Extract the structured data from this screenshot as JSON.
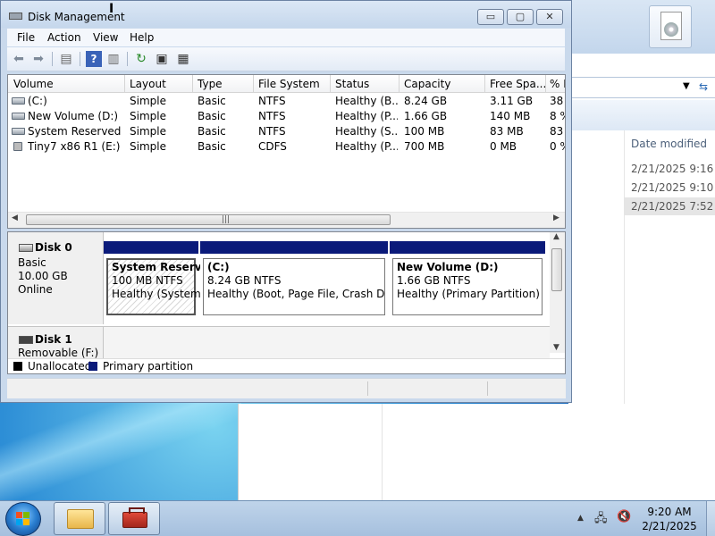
{
  "window": {
    "title": "Disk Management",
    "menu": [
      "File",
      "Action",
      "View",
      "Help"
    ],
    "controls": {
      "minimize": "▭",
      "maximize": "▢",
      "close": "✕"
    }
  },
  "volume_list": {
    "columns": [
      "Volume",
      "Layout",
      "Type",
      "File System",
      "Status",
      "Capacity",
      "Free Spa...",
      "% F"
    ],
    "rows": [
      {
        "volume": "(C:)",
        "layout": "Simple",
        "type": "Basic",
        "fs": "NTFS",
        "status": "Healthy (B...",
        "capacity": "8.24 GB",
        "free": "3.11 GB",
        "pct": "38",
        "icon": "drive-icon"
      },
      {
        "volume": "New Volume (D:)",
        "layout": "Simple",
        "type": "Basic",
        "fs": "NTFS",
        "status": "Healthy (P...",
        "capacity": "1.66 GB",
        "free": "140 MB",
        "pct": "8 %",
        "icon": "drive-icon"
      },
      {
        "volume": "System Reserved",
        "layout": "Simple",
        "type": "Basic",
        "fs": "NTFS",
        "status": "Healthy (S...",
        "capacity": "100 MB",
        "free": "83 MB",
        "pct": "83",
        "icon": "drive-icon"
      },
      {
        "volume": "Tiny7 x86 R1 (E:)",
        "layout": "Simple",
        "type": "Basic",
        "fs": "CDFS",
        "status": "Healthy (P...",
        "capacity": "700 MB",
        "free": "0 MB",
        "pct": "0 %",
        "icon": "cd-drive-icon"
      }
    ]
  },
  "disks": [
    {
      "name": "Disk 0",
      "kind": "Basic",
      "size": "10.00 GB",
      "state": "Online",
      "partitions": [
        {
          "title": "System Reserved",
          "size": "100 MB NTFS",
          "status": "Healthy (System,"
        },
        {
          "title": "(C:)",
          "size": "8.24 GB NTFS",
          "status": "Healthy (Boot, Page File, Crash Dump"
        },
        {
          "title": "New Volume  (D:)",
          "size": "1.66 GB NTFS",
          "status": "Healthy (Primary Partition)"
        }
      ]
    },
    {
      "name": "Disk 1",
      "kind": "Removable (F:)"
    }
  ],
  "legend": {
    "unallocated": "Unallocated",
    "primary": "Primary partition",
    "unallocated_color": "#000000",
    "primary_color": "#0a1a7a"
  },
  "explorer": {
    "column": "Date modified",
    "dates": [
      "2/21/2025 9:16 AM",
      "2/21/2025 9:10 AM",
      "2/21/2025 7:52 AM"
    ]
  },
  "taskbar": {
    "time": "9:20 AM",
    "date": "2/21/2025",
    "tray_arrow": "▲"
  }
}
